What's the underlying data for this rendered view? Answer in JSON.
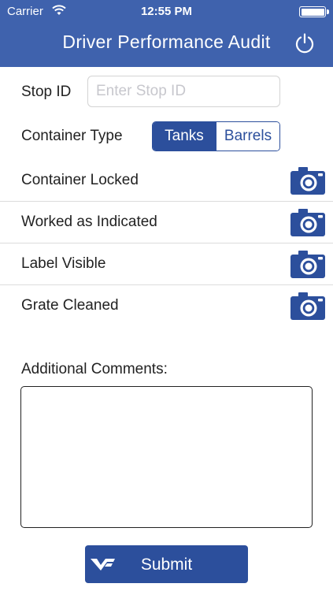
{
  "status_bar": {
    "carrier": "Carrier",
    "time": "12:55 PM",
    "wifi_icon": "wifi-icon",
    "battery_icon": "battery-icon"
  },
  "header": {
    "title": "Driver Performance Audit",
    "action_icon": "power-icon"
  },
  "stop": {
    "label": "Stop ID",
    "placeholder": "Enter Stop ID",
    "value": ""
  },
  "container_type": {
    "label": "Container Type",
    "options": [
      "Tanks",
      "Barrels"
    ],
    "selected": "Tanks"
  },
  "checks": [
    {
      "label": "Container Locked",
      "icon": "camera-icon"
    },
    {
      "label": "Worked as Indicated",
      "icon": "camera-icon"
    },
    {
      "label": "Label Visible",
      "icon": "camera-icon"
    },
    {
      "label": "Grate Cleaned",
      "icon": "camera-icon"
    }
  ],
  "comments": {
    "label": "Additional Comments:",
    "value": ""
  },
  "submit": {
    "label": "Submit",
    "logo_icon": "vp-logo-icon"
  },
  "colors": {
    "header": "#3f62ad",
    "accent": "#2c4f9c",
    "divider": "#dcdcdc"
  }
}
